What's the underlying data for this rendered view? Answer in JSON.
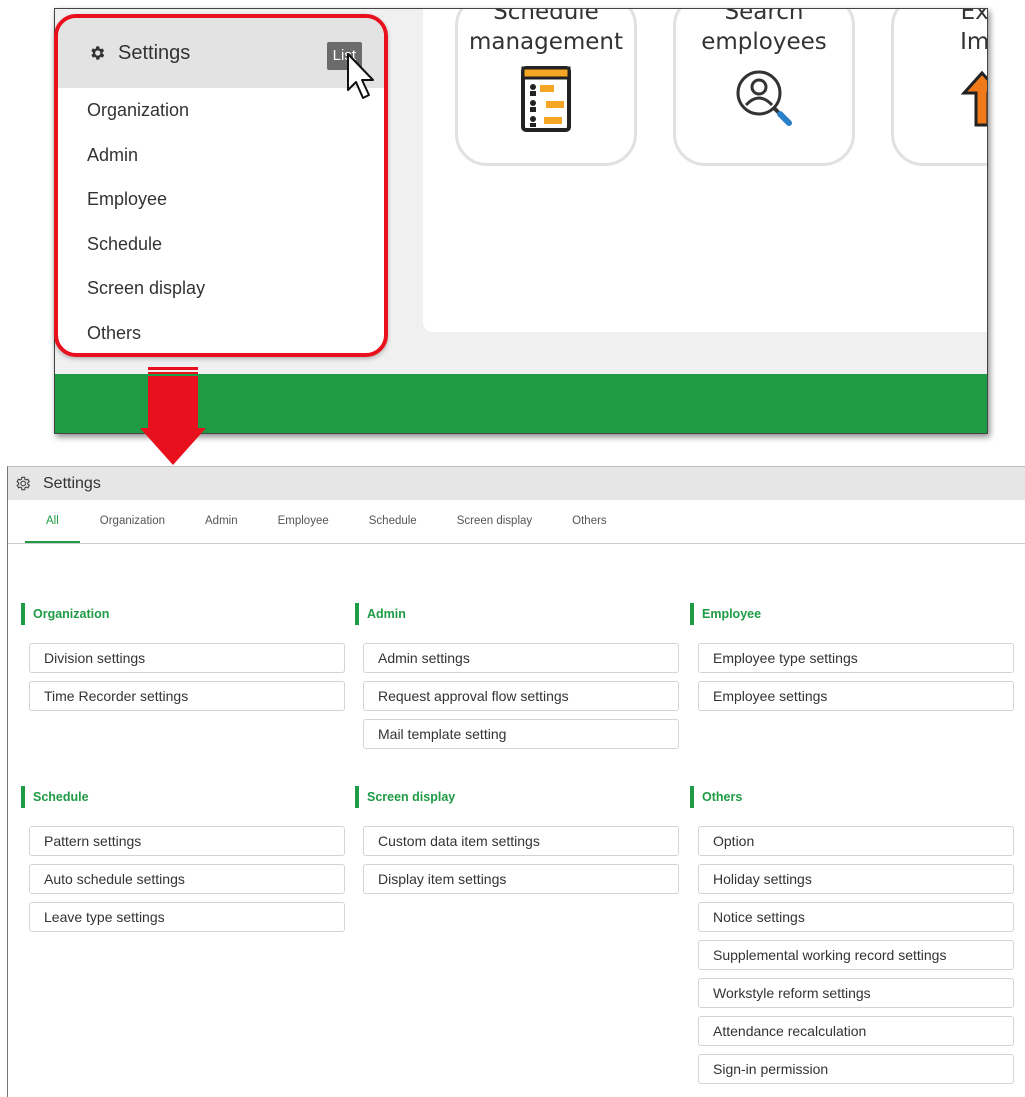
{
  "top": {
    "cards": [
      {
        "label": "Schedule\nmanagement",
        "icon": "schedule-chart-icon"
      },
      {
        "label": "Search\nemployees",
        "icon": "search-person-icon"
      },
      {
        "label": "Exp\nImp",
        "icon": "up-arrow-icon"
      }
    ],
    "side_menu": {
      "title": "Settings",
      "list_button": "List",
      "items": [
        "Organization",
        "Admin",
        "Employee",
        "Schedule",
        "Screen display",
        "Others"
      ]
    }
  },
  "settings": {
    "title": "Settings",
    "tabs": [
      "All",
      "Organization",
      "Admin",
      "Employee",
      "Schedule",
      "Screen display",
      "Others"
    ],
    "active_tab": "All",
    "sections": [
      {
        "title": "Organization",
        "items": [
          "Division settings",
          "Time Recorder settings"
        ]
      },
      {
        "title": "Admin",
        "items": [
          "Admin settings",
          "Request approval flow settings",
          "Mail template setting"
        ]
      },
      {
        "title": "Employee",
        "items": [
          "Employee type settings",
          "Employee settings"
        ]
      },
      {
        "title": "Schedule",
        "items": [
          "Pattern settings",
          "Auto schedule settings",
          "Leave type settings"
        ]
      },
      {
        "title": "Screen display",
        "items": [
          "Custom data item settings",
          "Display item settings"
        ]
      },
      {
        "title": "Others",
        "items": [
          "Option",
          "Holiday settings",
          "Notice settings",
          "Supplemental working record settings",
          "Workstyle reform settings",
          "Attendance recalculation",
          "Sign-in permission"
        ]
      }
    ]
  },
  "colors": {
    "accent": "#1f9b45",
    "highlight": "#e8101c"
  }
}
